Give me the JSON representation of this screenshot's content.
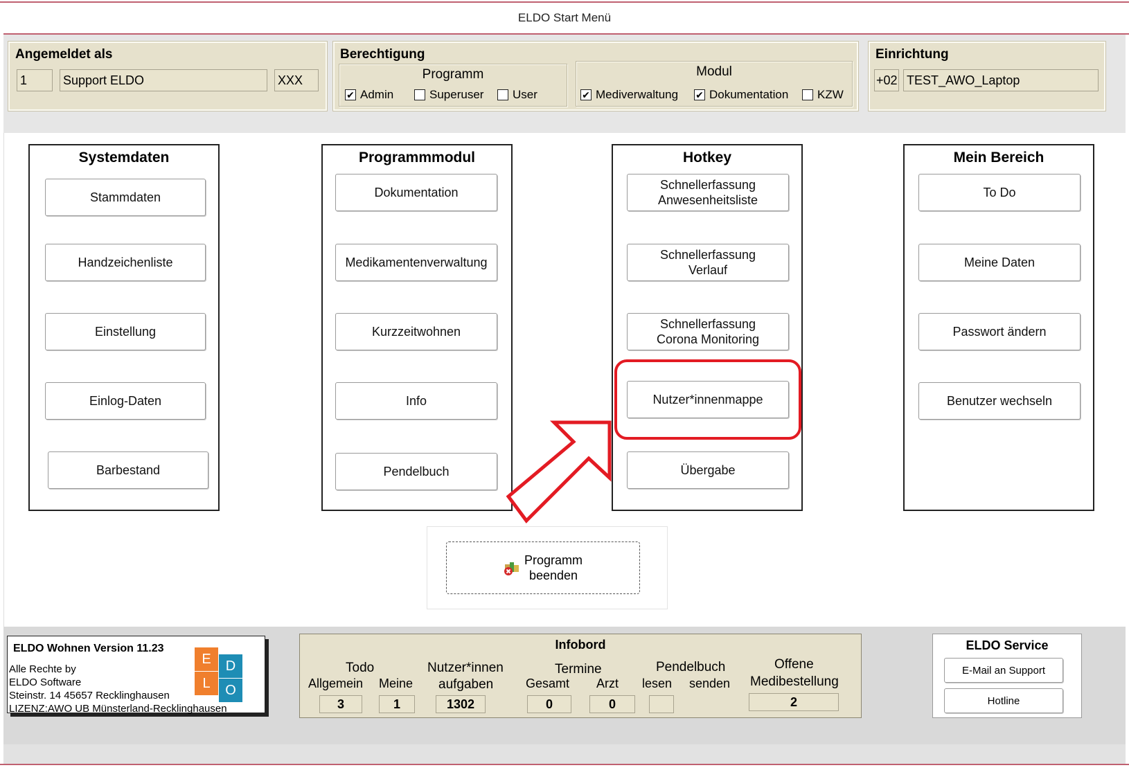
{
  "window": {
    "title": "ELDO Start Menü"
  },
  "login": {
    "title": "Angemeldet als",
    "user_id": "1",
    "user_name": "Support ELDO",
    "user_code": "XXX"
  },
  "permission": {
    "title": "Berechtigung",
    "program": {
      "title": "Programm",
      "admin": {
        "label": "Admin",
        "checked": true
      },
      "superuser": {
        "label": "Superuser",
        "checked": false
      },
      "user": {
        "label": "User",
        "checked": false
      }
    },
    "module": {
      "title": "Modul",
      "mediverwaltung": {
        "label": "Mediverwaltung",
        "checked": true
      },
      "dokumentation": {
        "label": "Dokumentation",
        "checked": true
      },
      "kzw": {
        "label": "KZW",
        "checked": false
      }
    },
    "check_mark": "✔"
  },
  "facility": {
    "title": "Einrichtung",
    "code": "+02",
    "name": "TEST_AWO_Laptop"
  },
  "sections": {
    "systemdaten": {
      "title": "Systemdaten",
      "buttons": [
        "Stammdaten",
        "Handzeichenliste",
        "Einstellung",
        "Einlog-Daten",
        "Barbestand"
      ]
    },
    "programmmodul": {
      "title": "Programmmodul",
      "buttons": [
        "Dokumentation",
        "Medikamentenverwaltung",
        "Kurzzeitwohnen",
        "Info",
        "Pendelbuch"
      ]
    },
    "hotkey": {
      "title": "Hotkey",
      "buttons": [
        {
          "line1": "Schnellerfassung",
          "line2": "Anwesenheitsliste"
        },
        {
          "line1": "Schnellerfassung",
          "line2": "Verlauf"
        },
        {
          "line1": "Schnellerfassung",
          "line2": "Corona Monitoring"
        },
        {
          "line1": "Nutzer*innenmappe",
          "line2": ""
        },
        {
          "line1": "Übergabe",
          "line2": ""
        }
      ]
    },
    "mein_bereich": {
      "title": "Mein Bereich",
      "buttons": [
        "To Do",
        "Meine Daten",
        "Passwort ändern",
        "Benutzer wechseln"
      ]
    }
  },
  "exit": {
    "line1": "Programm",
    "line2": "beenden",
    "icon": "exit-program-icon"
  },
  "license": {
    "version": "ELDO Wohnen Version 11.23",
    "line1": "Alle Rechte by",
    "line2": "ELDO Software",
    "line3": "Steinstr. 14 45657 Recklinghausen",
    "line4": "LIZENZ:AWO UB Münsterland-Recklinghausen",
    "logo_letters": [
      "E",
      "D",
      "L",
      "O"
    ]
  },
  "infobord": {
    "title": "Infobord",
    "todo": {
      "title": "Todo",
      "allgemein_label": "Allgemein",
      "meine_label": "Meine",
      "allgemein": "3",
      "meine": "1"
    },
    "nutzer": {
      "line1": "Nutzer*innen",
      "line2": "aufgaben",
      "value": "1302"
    },
    "termine": {
      "title": "Termine",
      "gesamt_label": "Gesamt",
      "arzt_label": "Arzt",
      "gesamt": "0",
      "arzt": "0"
    },
    "pendelbuch": {
      "title": "Pendelbuch",
      "lesen_label": "lesen",
      "senden_label": "senden",
      "value": ""
    },
    "medibestellung": {
      "line1": "Offene",
      "line2": "Medibestellung",
      "value": "2"
    }
  },
  "service": {
    "title": "ELDO Service",
    "email_label": "E-Mail an Support",
    "hotline_label": "Hotline"
  },
  "colors": {
    "panel_bg": "#e6e1cc",
    "highlight": "#e31b23",
    "logo_orange": "#f07f2d",
    "logo_blue": "#1e8db5"
  }
}
